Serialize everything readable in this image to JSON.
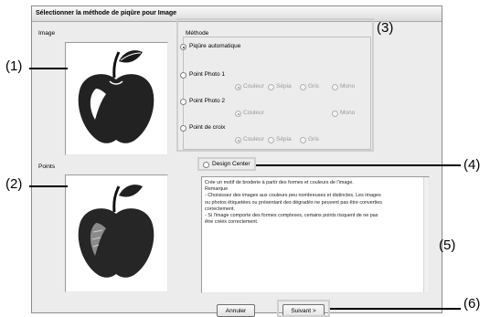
{
  "dialog": {
    "title": "Sélectionner la méthode de piqûre pour Image",
    "image_label": "Image",
    "points_label": "Points"
  },
  "method": {
    "group_label": "Méthode",
    "auto": "Piqûre automatique",
    "photo1": "Point Photo 1",
    "photo2": "Point Photo 2",
    "cross": "Point de croix",
    "opts": {
      "couleur": "Couleur",
      "sepia": "Sépia",
      "gris": "Gris",
      "mono": "Mono"
    }
  },
  "design_center": {
    "label": "Design Center"
  },
  "description": {
    "lines": [
      "Crée un motif de broderie à partir des formes et couleurs de l'image.",
      "Remarque",
      "- Choisissez des images aux couleurs peu nombreuses et distinctes. Les images",
      "ou photos étiquetées ou présentant des dégradés ne peuvent pas être converties",
      "correctement.",
      "- Si l'image comporte des formes complexes, certains points risquent de ne pas",
      "être créés correctement."
    ]
  },
  "buttons": {
    "cancel": "Annuler",
    "next": "Suivant >"
  },
  "callouts": {
    "c1": "(1)",
    "c2": "(2)",
    "c3": "(3)",
    "c4": "(4)",
    "c5": "(5)",
    "c6": "(6)"
  },
  "colors": {
    "dialog_bg": "#ececec",
    "callout_border": "#cfcfcf"
  }
}
